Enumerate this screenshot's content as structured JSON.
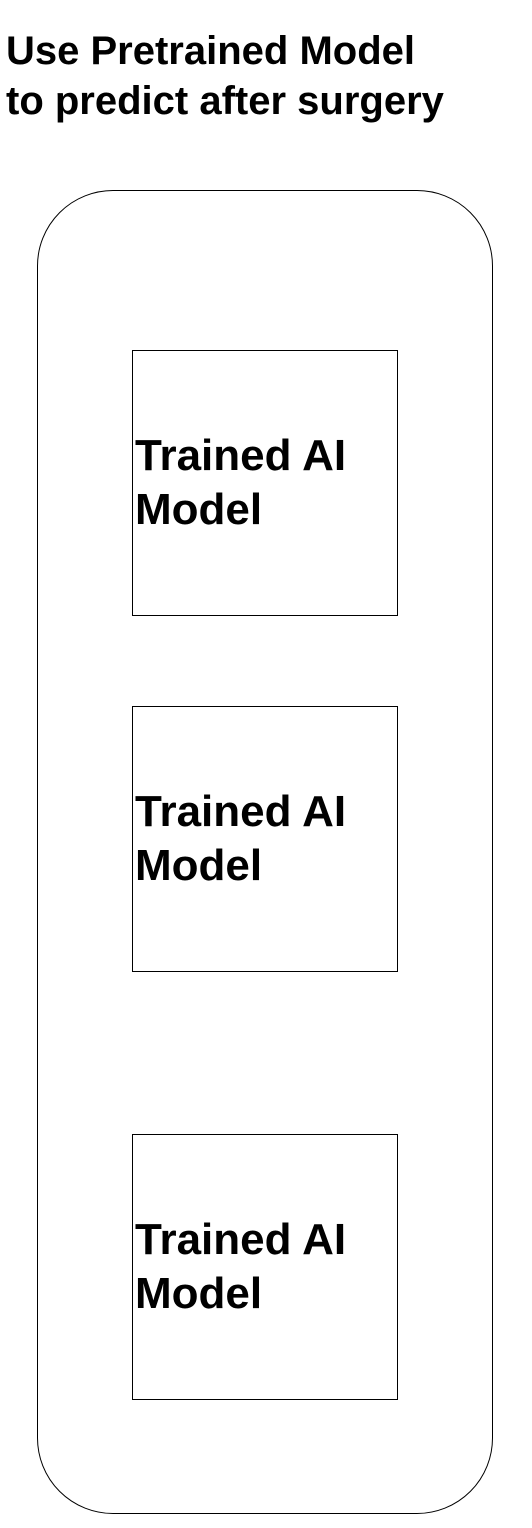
{
  "title": {
    "line1": "Use Pretrained Model",
    "line2": "to predict after surgery"
  },
  "models": [
    {
      "label": "Trained AI Model"
    },
    {
      "label": "Trained AI Model"
    },
    {
      "label": "Trained AI Model"
    }
  ],
  "colors": {
    "stroke": "#000000",
    "background": "#ffffff",
    "text": "#000000"
  }
}
